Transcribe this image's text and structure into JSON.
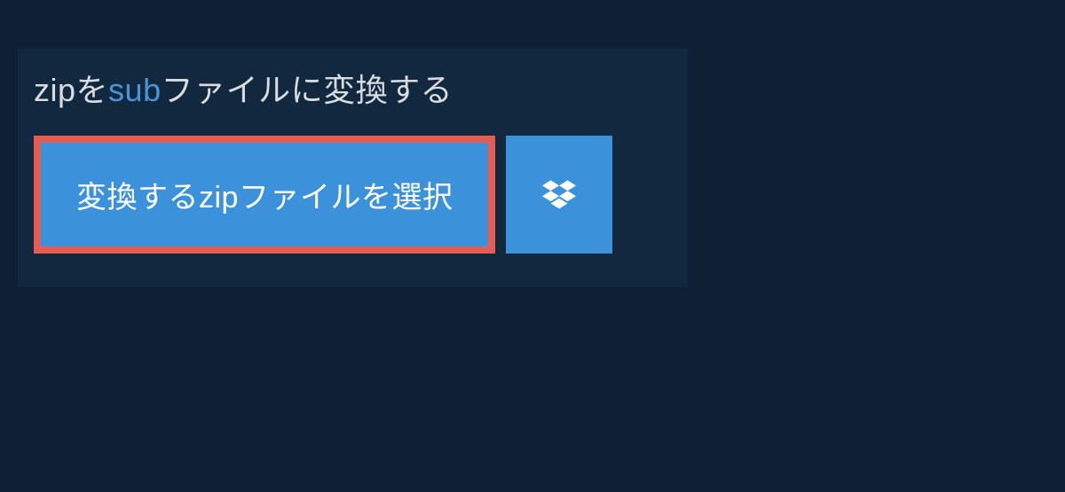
{
  "header": {
    "title_prefix": "zip",
    "title_mid1": "を",
    "title_highlight": "sub",
    "title_suffix": "ファイルに変換する"
  },
  "buttons": {
    "select_label": "変換するzipファイルを選択",
    "dropbox_icon_name": "dropbox-icon"
  },
  "colors": {
    "background": "#0d2035",
    "panel": "#12283f",
    "accent_blue": "#3b92db",
    "highlight_red": "#e35d53",
    "text_light": "#d8dcdf",
    "link_blue": "#4a95d7"
  }
}
